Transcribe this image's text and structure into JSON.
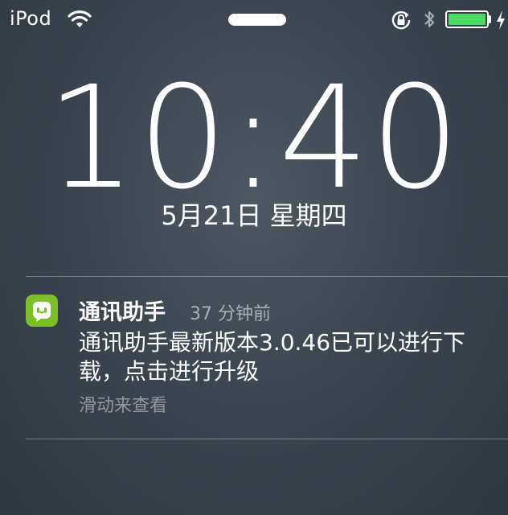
{
  "status_bar": {
    "carrier": "iPod",
    "wifi_icon": "wifi-icon",
    "rotation_lock_icon": "rotation-lock-icon",
    "bluetooth_icon": "bluetooth-icon",
    "battery_icon": "battery-icon",
    "battery_level": 1.0,
    "charging_icon": "charging-bolt-icon"
  },
  "lock_screen": {
    "time": "10:40",
    "date": "5月21日 星期四"
  },
  "notification": {
    "app_icon": "chat-bubble-icon",
    "app_name": "通讯助手",
    "time_ago": "37 分钟前",
    "message": "通讯助手最新版本3.0.46已可以进行下载，点击进行升级",
    "action_hint": "滑动来查看"
  },
  "colors": {
    "battery_fill": "#4cd964",
    "app_icon_bg": "#7cbf2a"
  }
}
